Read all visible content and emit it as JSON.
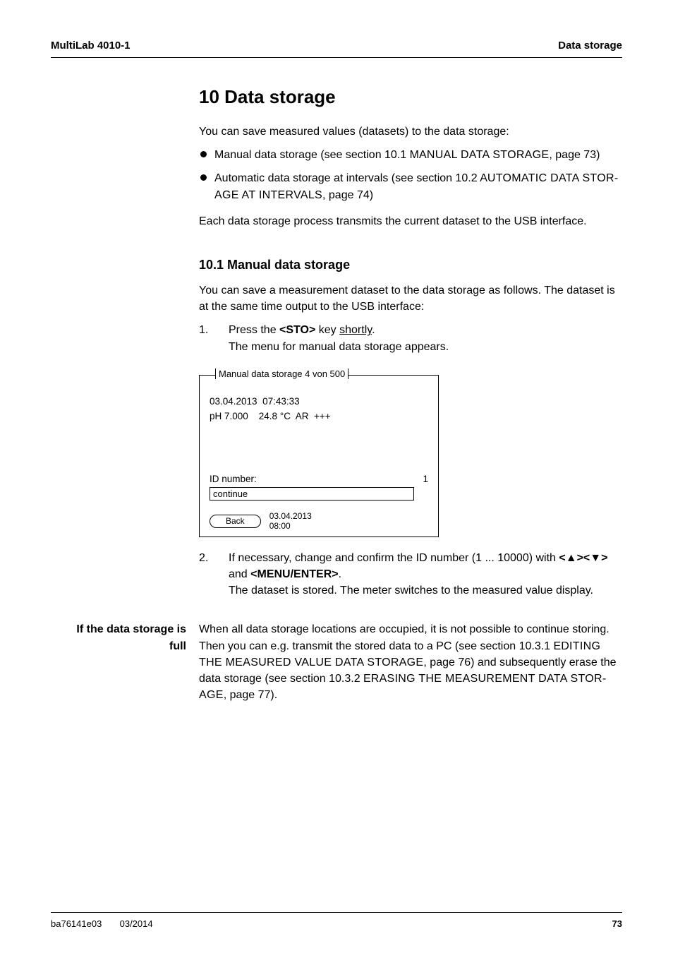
{
  "header": {
    "left": "MultiLab 4010-1",
    "right": "Data storage"
  },
  "title": "10    Data storage",
  "intro": "You can save measured values (datasets) to the data storage:",
  "bullets": {
    "b1_pre": "Manual data storage (see section 10.1 M",
    "b1_sc": "ANUAL DATA STORAGE",
    "b1_post": ", page 73)",
    "b2_pre": "Automatic data storage at intervals (see section 10.2 A",
    "b2_sc": "UTOMATIC DATA STOR-AGE AT INTERVALS",
    "b2_post": ", page 74)"
  },
  "after_bullets": "Each data storage process transmits the current dataset to the USB interface.",
  "subsection": "10.1   Manual data storage",
  "sub_intro": "You can save a measurement dataset to the data storage as follows. The dataset is at the same time output to the USB interface:",
  "steps": {
    "s1": {
      "num": "1.",
      "l1a": "Press the ",
      "l1b": "<STO>",
      "l1c": " key ",
      "l1d": "shortly",
      "l1e": ".",
      "l2": "The menu for manual data storage appears."
    },
    "s2": {
      "num": "2.",
      "l1a": "If necessary, change and confirm the ID number (1 ... 10000) with ",
      "l1b": "<▲><▼>",
      "l1c": " and ",
      "l1d": "<MENU/ENTER>",
      "l1e": ".",
      "l2": "The dataset is stored. The meter switches to the measured value display."
    }
  },
  "device": {
    "title": "Manual data storage 4 von 500",
    "line1": "03.04.2013  07:43:33",
    "line2": "pH 7.000    24.8 °C  AR  +++",
    "id_label": "ID number:",
    "id_value": "1",
    "continue_label": "continue",
    "back": "Back",
    "ts1": "03.04.2013",
    "ts2": "08:00"
  },
  "side": {
    "label_l1": "If the data storage is",
    "label_l2": "full",
    "body_a": "When all data storage locations are occupied, it is not possible to continue storing. Then you can e.g. transmit the stored data to a PC (see section 10.3.1 E",
    "body_sc1": "DITING THE MEASURED VALUE DATA STORAGE",
    "body_b": ", page 76) and subsequently erase the data storage (see section 10.3.2 E",
    "body_sc2": "RASING THE MEASUREMENT DATA STOR-AGE",
    "body_c": ", page 77)."
  },
  "footer": {
    "left_a": "ba76141e03",
    "left_b": "03/2014",
    "page": "73"
  }
}
